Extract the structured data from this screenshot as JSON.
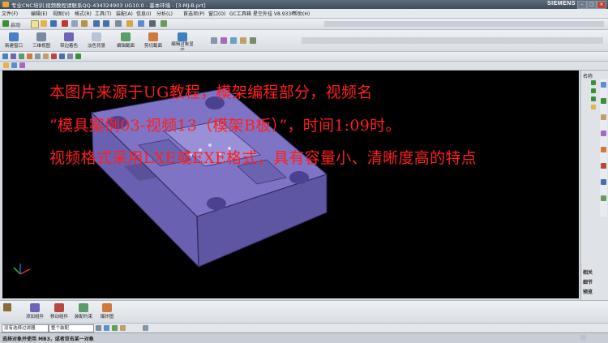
{
  "window": {
    "title": "专业CNC培训,视频教程请联系QQ-434324903 UG10.0 - 基本环境 - [3-MJ-B.prt]",
    "brand": "SIEMENS"
  },
  "menu": [
    "文件(F)",
    "编辑(E)",
    "视图(V)",
    "格式(R)",
    "工具(T)",
    "装配(A)",
    "信息(I)",
    "分析(L)",
    "首选项(P)",
    "窗口(O)",
    "GC工具箱",
    "星空外挂 V8.933F",
    "帮助(H)"
  ],
  "toolbar": {
    "start_label": "启动",
    "buttons": [
      "新建窗口",
      "三维视图",
      "带边着色",
      "淡色背景",
      "编辑截面",
      "剪切截面",
      "编辑对象显示"
    ]
  },
  "overlay": {
    "line1": "本图片来源于UG教程，模架编程部分，视频名",
    "line2": "“模具案例03-视频13（模架B板）”，时间1:09时。",
    "line3": "视频格式采用LXE或EXE格式，具有容量小、清晰度高的特点"
  },
  "right_panel": {
    "header": "名称",
    "labels": [
      "相关",
      "细节",
      "预览"
    ]
  },
  "assembly_toolbar": [
    "添加组件",
    "移动组件",
    "装配约束",
    "爆炸图"
  ],
  "selection_bar": {
    "filter": "没有选择过滤器",
    "scope": "整个装配"
  },
  "status": {
    "prompt": "选择对象并使用 MB3，或者双击某一对象"
  },
  "colors": {
    "overlay_text": "#ff1f1f",
    "model": "#7e73c4",
    "viewport_bg": "#000000"
  }
}
